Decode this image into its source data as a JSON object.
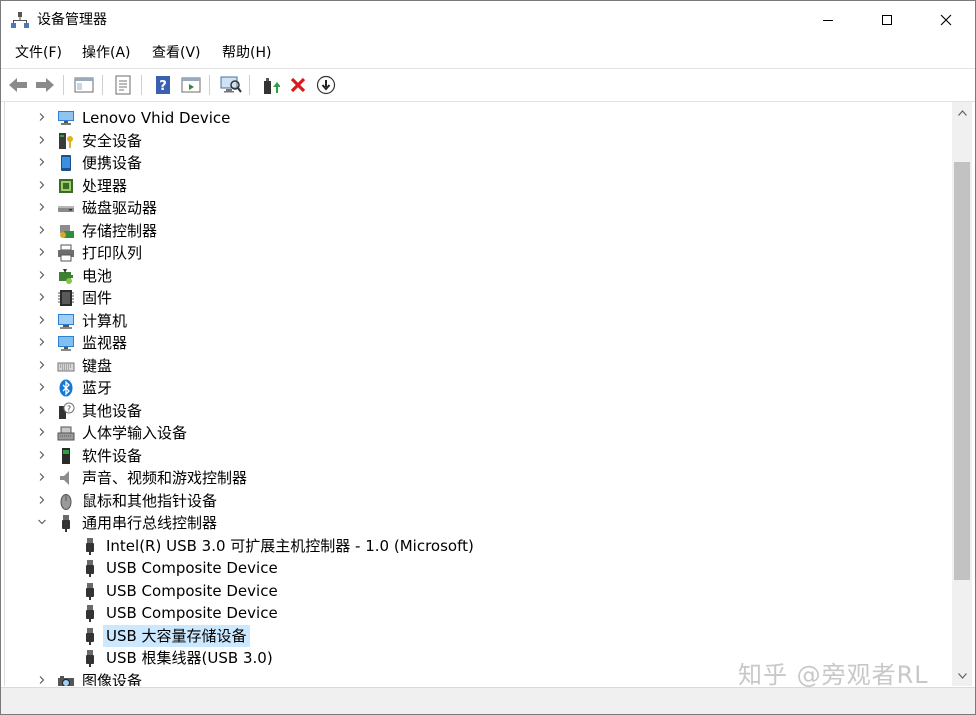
{
  "window": {
    "title": "设备管理器"
  },
  "menu": {
    "items": [
      "文件(F)",
      "操作(A)",
      "查看(V)",
      "帮助(H)"
    ]
  },
  "toolbar": {
    "buttons": [
      "back-arrow-icon",
      "forward-arrow-icon",
      "show-hide-tree-icon",
      "properties-icon",
      "help-icon",
      "action-pane-icon",
      "scan-hardware-icon",
      "update-driver-icon",
      "uninstall-icon",
      "disable-device-icon"
    ]
  },
  "tree": {
    "items": [
      {
        "label": "Lenovo Vhid Device",
        "icon": "monitor-network-icon",
        "level": 0,
        "expanded": false
      },
      {
        "label": "安全设备",
        "icon": "security-key-icon",
        "level": 0,
        "expanded": false
      },
      {
        "label": "便携设备",
        "icon": "portable-device-icon",
        "level": 0,
        "expanded": false
      },
      {
        "label": "处理器",
        "icon": "processor-icon",
        "level": 0,
        "expanded": false
      },
      {
        "label": "磁盘驱动器",
        "icon": "disk-drive-icon",
        "level": 0,
        "expanded": false
      },
      {
        "label": "存储控制器",
        "icon": "storage-controller-icon",
        "level": 0,
        "expanded": false
      },
      {
        "label": "打印队列",
        "icon": "printer-icon",
        "level": 0,
        "expanded": false
      },
      {
        "label": "电池",
        "icon": "battery-icon",
        "level": 0,
        "expanded": false
      },
      {
        "label": "固件",
        "icon": "firmware-icon",
        "level": 0,
        "expanded": false
      },
      {
        "label": "计算机",
        "icon": "computer-icon",
        "level": 0,
        "expanded": false
      },
      {
        "label": "监视器",
        "icon": "monitor-icon",
        "level": 0,
        "expanded": false
      },
      {
        "label": "键盘",
        "icon": "keyboard-icon",
        "level": 0,
        "expanded": false
      },
      {
        "label": "蓝牙",
        "icon": "bluetooth-icon",
        "level": 0,
        "expanded": false
      },
      {
        "label": "其他设备",
        "icon": "other-device-icon",
        "level": 0,
        "expanded": false
      },
      {
        "label": "人体学输入设备",
        "icon": "hid-icon",
        "level": 0,
        "expanded": false
      },
      {
        "label": "软件设备",
        "icon": "software-device-icon",
        "level": 0,
        "expanded": false
      },
      {
        "label": "声音、视频和游戏控制器",
        "icon": "speaker-icon",
        "level": 0,
        "expanded": false
      },
      {
        "label": "鼠标和其他指针设备",
        "icon": "mouse-icon",
        "level": 0,
        "expanded": false
      },
      {
        "label": "通用串行总线控制器",
        "icon": "usb-icon",
        "level": 0,
        "expanded": true
      },
      {
        "label": "Intel(R) USB 3.0 可扩展主机控制器 - 1.0 (Microsoft)",
        "icon": "usb-icon",
        "level": 1
      },
      {
        "label": "USB Composite Device",
        "icon": "usb-icon",
        "level": 1
      },
      {
        "label": "USB Composite Device",
        "icon": "usb-icon",
        "level": 1
      },
      {
        "label": "USB Composite Device",
        "icon": "usb-icon",
        "level": 1
      },
      {
        "label": "USB 大容量存储设备",
        "icon": "usb-icon",
        "level": 1,
        "selected": true
      },
      {
        "label": "USB 根集线器(USB 3.0)",
        "icon": "usb-icon",
        "level": 1
      },
      {
        "label": "图像设备",
        "icon": "imaging-device-icon",
        "level": 0,
        "expanded": false
      }
    ]
  },
  "watermark": "知乎 @旁观者RL",
  "colors": {
    "selection": "#cce8ff",
    "accent": "#0078d7"
  }
}
